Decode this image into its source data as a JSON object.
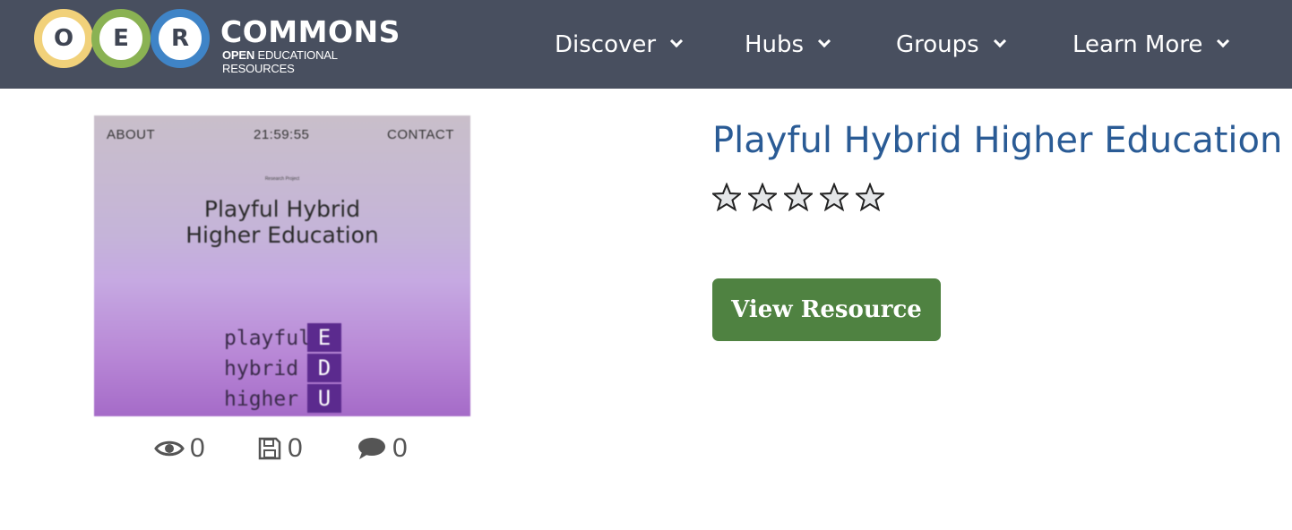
{
  "header": {
    "logo": {
      "letters": [
        "O",
        "E",
        "R"
      ],
      "wordmark": "COMMONS",
      "tagline_bold": "OPEN",
      "tagline_rest": "EDUCATIONAL RESOURCES",
      "colors": {
        "o": "#f1d17a",
        "e": "#8ab253",
        "r": "#3f84c7"
      }
    },
    "nav": [
      {
        "label": "Discover",
        "icon": "chevron-down-icon"
      },
      {
        "label": "Hubs",
        "icon": "chevron-down-icon"
      },
      {
        "label": "Groups",
        "icon": "chevron-down-icon"
      },
      {
        "label": "Learn More",
        "icon": "chevron-down-icon"
      }
    ],
    "background": "#484f5f"
  },
  "thumbnail": {
    "about": "ABOUT",
    "time": "21:59:55",
    "contact": "CONTACT",
    "small_text": "Research Project",
    "title_line1": "Playful Hybrid",
    "title_line2": "Higher Education",
    "words": [
      "playful",
      "hybrid",
      "higher"
    ],
    "letters": [
      "E",
      "D",
      "U"
    ]
  },
  "stats": {
    "views": "0",
    "saves": "0",
    "comments": "0"
  },
  "resource": {
    "title": "Playful Hybrid Higher Education",
    "rating": {
      "value": 0,
      "max": 5
    },
    "button_label": "View Resource",
    "button_color": "#4f8241",
    "title_color": "#2a5b95"
  }
}
